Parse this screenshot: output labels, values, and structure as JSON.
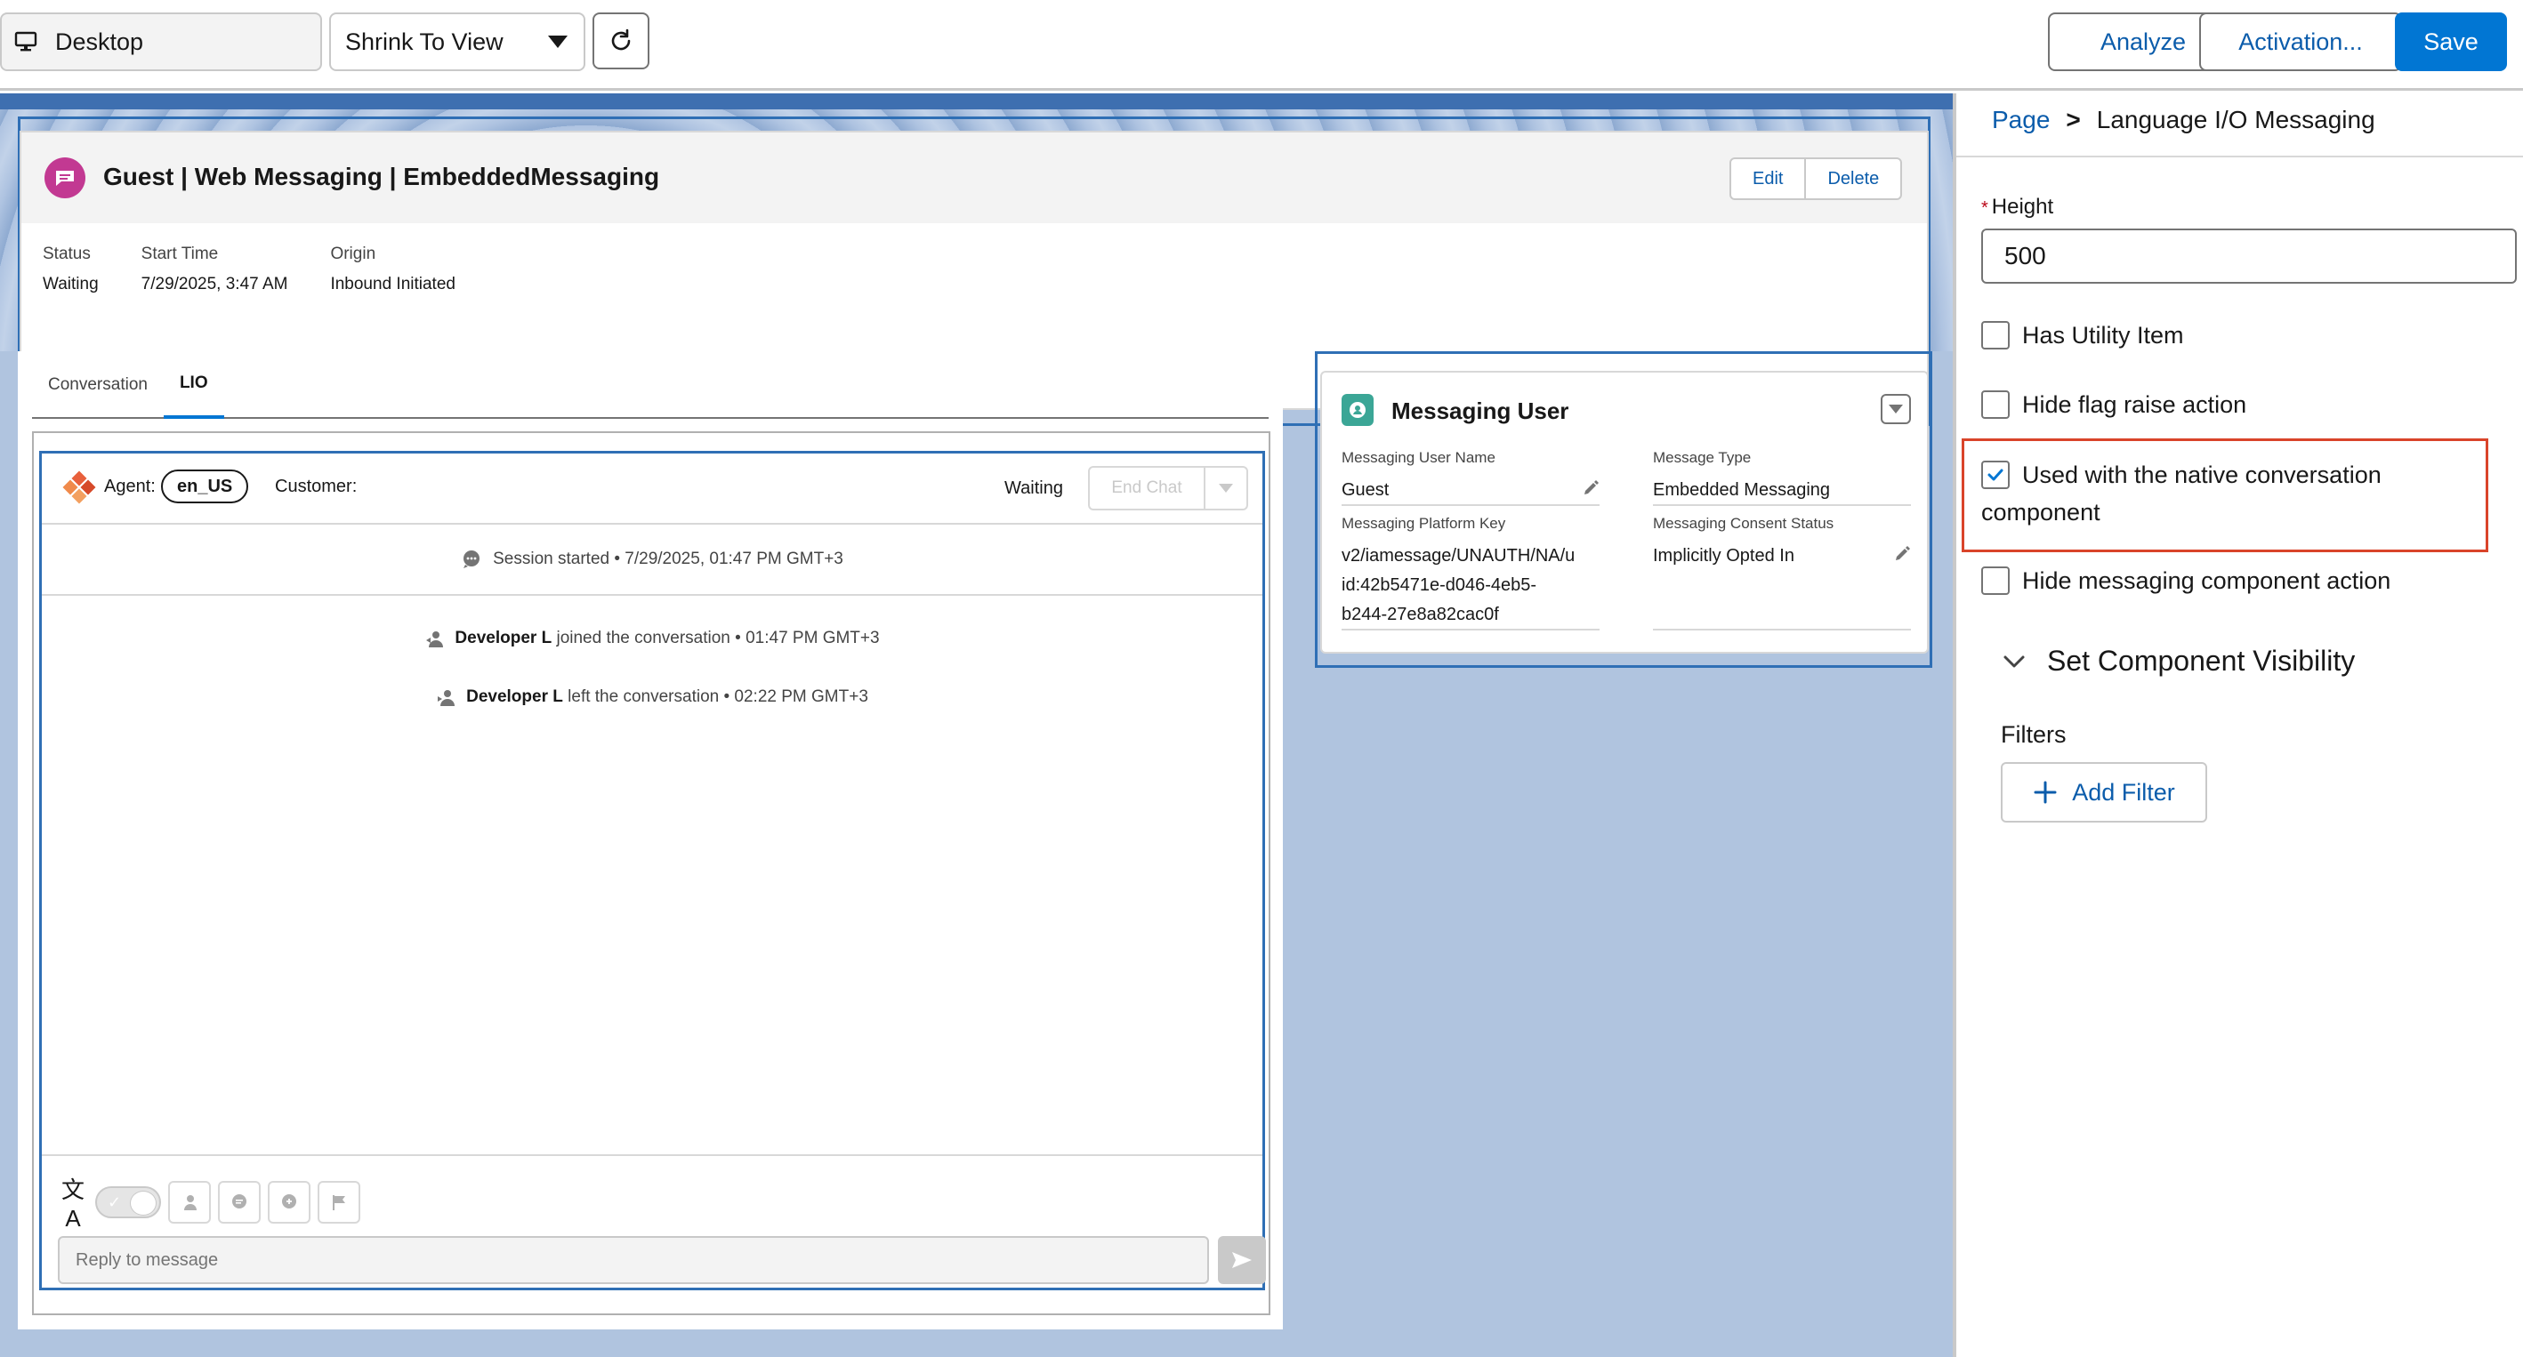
{
  "toolbar": {
    "device": "Desktop",
    "zoom": "Shrink To View",
    "analyze": "Analyze",
    "activation": "Activation...",
    "save": "Save"
  },
  "record": {
    "title": "Guest | Web Messaging | EmbeddedMessaging",
    "edit": "Edit",
    "delete": "Delete",
    "fields": [
      {
        "label": "Status",
        "value": "Waiting"
      },
      {
        "label": "Start Time",
        "value": "7/29/2025, 3:47 AM"
      },
      {
        "label": "Origin",
        "value": "Inbound Initiated"
      }
    ]
  },
  "tabs": [
    {
      "label": "Conversation",
      "active": false
    },
    {
      "label": "LIO",
      "active": true
    }
  ],
  "conversation": {
    "agent_label": "Agent:",
    "agent_lang": "en_US",
    "customer_label": "Customer:",
    "status": "Waiting",
    "end_chat": "End Chat",
    "session_started": "Session started • 7/29/2025, 01:47 PM GMT+3",
    "events": [
      {
        "name": "Developer L",
        "text": "joined the conversation • 01:47 PM GMT+3"
      },
      {
        "name": "Developer L",
        "text": "left the conversation • 02:22 PM GMT+3"
      }
    ],
    "reply_placeholder": "Reply to message",
    "translate_glyph": "文A"
  },
  "messaging_user": {
    "title": "Messaging User",
    "fields": [
      {
        "label": "Messaging User Name",
        "value": "Guest",
        "editable": true
      },
      {
        "label": "Message Type",
        "value": "Embedded Messaging",
        "editable": false
      },
      {
        "label": "Messaging Platform Key",
        "value": "v2/iamessage/UNAUTH/NA/u\nid:42b5471e-d046-4eb5-\nb244-27e8a82cac0f",
        "editable": false
      },
      {
        "label": "Messaging Consent Status",
        "value": "Implicitly Opted In",
        "editable": true
      }
    ]
  },
  "panel": {
    "breadcrumb_root": "Page",
    "breadcrumb_sep": ">",
    "breadcrumb_current": "Language I/O Messaging",
    "height_label": "Height",
    "height_required": "*",
    "height_value": "500",
    "checkboxes": [
      {
        "label": "Has Utility Item",
        "checked": false
      },
      {
        "label": "Hide flag raise action",
        "checked": false
      },
      {
        "label": "Used with the native conversation component",
        "checked": true
      },
      {
        "label": "Hide messaging component action",
        "checked": false
      }
    ],
    "visibility_section": "Set Component Visibility",
    "filters_label": "Filters",
    "add_filter": "Add Filter"
  },
  "colors": {
    "brand_blue": "#0176d3",
    "link_blue": "#0b5cab",
    "highlight_red": "#d9442a",
    "canvas_bg": "#b0c4df",
    "record_icon": "#c23992",
    "user_icon": "#3ba696"
  }
}
